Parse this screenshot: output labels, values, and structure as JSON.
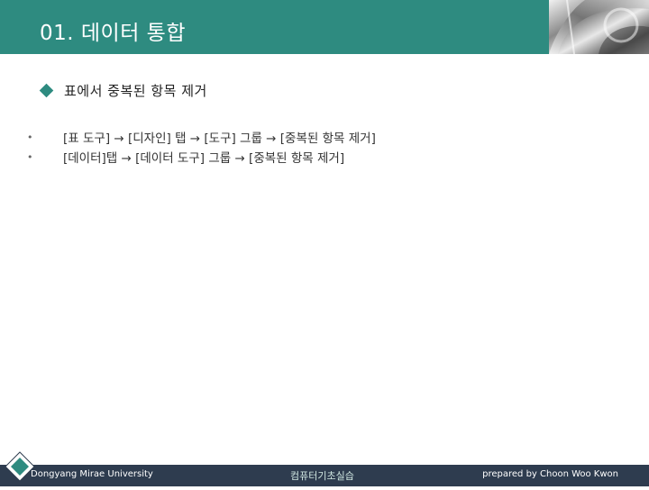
{
  "header": {
    "title": "01. 데이터 통합"
  },
  "main_bullet": {
    "text": "표에서 중복된 항목 제거"
  },
  "sub_bullets": [
    {
      "text": "[표 도구] → [디자인] 탭 → [도구] 그룹 → [중복된 항목 제거]"
    },
    {
      "text": "[데이터]탭 → [데이터 도구] 그룹 → [중복된 항목 제거]"
    }
  ],
  "footer": {
    "left": "Dongyang Mirae University",
    "center": "컴퓨터기초실습",
    "right": "prepared by Choon Woo Kwon"
  },
  "colors": {
    "accent": "#2e8b80",
    "footer_bg": "#2e3c4f"
  }
}
